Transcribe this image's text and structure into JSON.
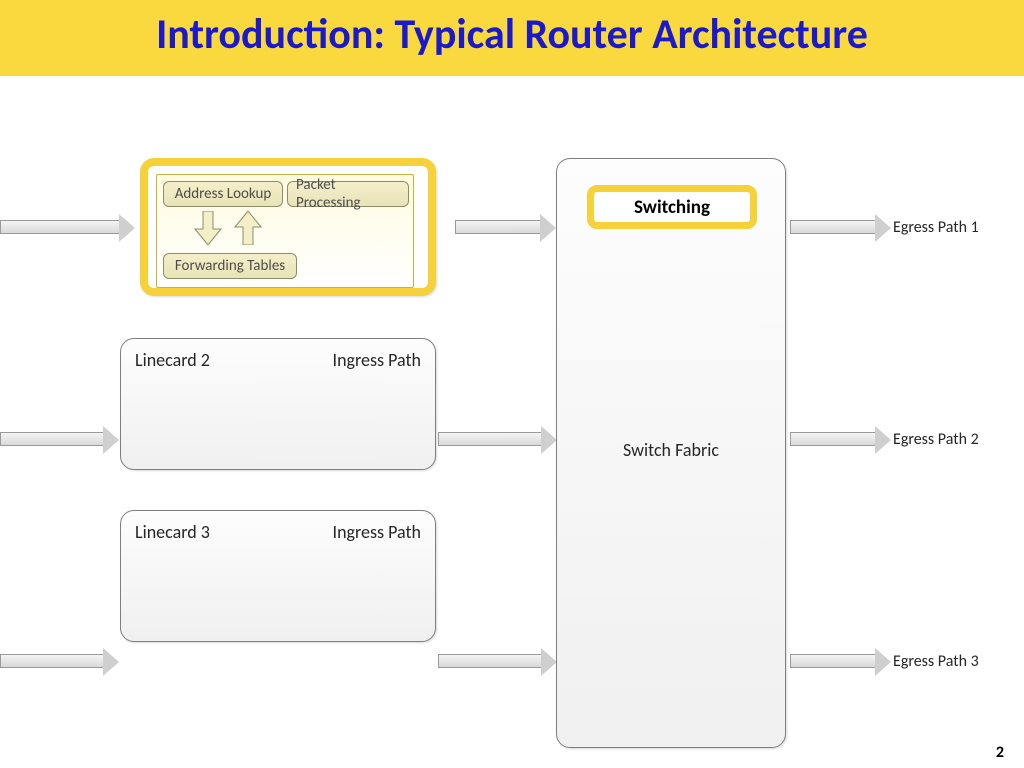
{
  "title": "Introduction: Typical Router Architecture",
  "linecard1": {
    "address_lookup": "Address Lookup",
    "packet_processing": "Packet Processing",
    "forwarding_tables": "Forwarding Tables"
  },
  "linecards": [
    {
      "name": "Linecard 2",
      "path": "Ingress Path"
    },
    {
      "name": "Linecard 3",
      "path": "Ingress Path"
    }
  ],
  "switch": {
    "highlight_label": "Switching",
    "fabric_label": "Switch Fabric"
  },
  "egress": [
    "Egress Path 1",
    "Egress Path 2",
    "Egress Path 3"
  ],
  "page_number": "2"
}
